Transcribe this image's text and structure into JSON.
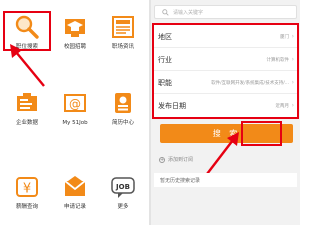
{
  "tiles": [
    {
      "label": "职位搜索",
      "icon": "magnifier-icon"
    },
    {
      "label": "校园招聘",
      "icon": "graduation-cap-icon"
    },
    {
      "label": "职场资讯",
      "icon": "news-icon"
    },
    {
      "label": "企业数据",
      "icon": "company-data-icon"
    },
    {
      "label": "My 51Job",
      "icon": "mail-at-icon"
    },
    {
      "label": "简历中心",
      "icon": "resume-badge-icon"
    },
    {
      "label": "薪酬查询",
      "icon": "yen-coin-icon"
    },
    {
      "label": "申请记录",
      "icon": "envelope-icon"
    },
    {
      "label": "更多",
      "icon": "job-bubble-icon"
    }
  ],
  "search": {
    "placeholder": "请输入关键字"
  },
  "form": {
    "rows": [
      {
        "key": "地区",
        "value": "厦门"
      },
      {
        "key": "行业",
        "value": "计算机软件"
      },
      {
        "key": "职能",
        "value": "软件/互联网开发/系统集成/技术支持/..."
      },
      {
        "key": "发布日期",
        "value": "近两月"
      }
    ]
  },
  "button": {
    "label": "搜 索"
  },
  "subscribe": {
    "label": "添加到订阅"
  },
  "history": {
    "label": "暂无历史搜索记录"
  },
  "colors": {
    "brand_orange": "#f28a18",
    "annotation_red": "#e60012"
  }
}
